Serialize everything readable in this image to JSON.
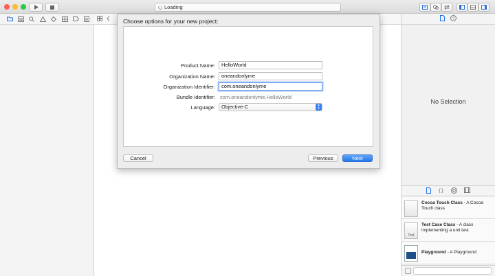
{
  "toolbar": {
    "activity": "Loading"
  },
  "colors": {
    "close": "#fd5f57",
    "minimize": "#fdbc2e",
    "zoom": "#28c840",
    "accent": "#2478ee"
  },
  "navigator": {
    "icons": [
      "folder-icon",
      "hierarchy-icon",
      "search-icon",
      "warning-icon",
      "test-icon",
      "debug-icon",
      "breakpoint-icon",
      "report-icon"
    ]
  },
  "dialog": {
    "title": "Choose options for your new project:",
    "fields": {
      "product_name_label": "Product Name:",
      "product_name_value": "HelloWorld",
      "organization_name_label": "Organization Name:",
      "organization_name_value": "oneandonlyme",
      "organization_identifier_label": "Organization Identifier:",
      "organization_identifier_value": "com.oneandonlyme",
      "bundle_identifier_label": "Bundle Identifier:",
      "bundle_identifier_value": "com.oneandonlyme.HelloWorld",
      "language_label": "Language:",
      "language_value": "Objective-C"
    },
    "buttons": {
      "cancel": "Cancel",
      "previous": "Previous",
      "next": "Next"
    }
  },
  "inspector": {
    "no_selection": "No Selection"
  },
  "library": {
    "items": [
      {
        "title": "Cocoa Touch Class",
        "desc": " - A Cocoa Touch class",
        "icon": "cocoa-touch-class-icon"
      },
      {
        "title": "Test Case Class",
        "desc": " - A class implementing a unit test",
        "icon_label": "Test",
        "icon": "test-case-class-icon"
      },
      {
        "title": "Playground",
        "desc": " - A Playground",
        "icon": "playground-icon"
      }
    ]
  }
}
